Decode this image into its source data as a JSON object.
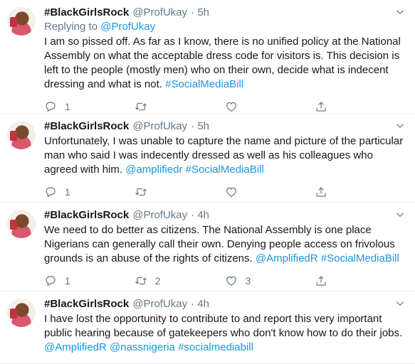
{
  "tweets": [
    {
      "display_name": "#BlackGirlsRock",
      "handle": "@ProfUkay",
      "time": "· 5h",
      "replying_prefix": "Replying to ",
      "replying_handle": "@ProfUkay",
      "text": "I am so pissed off. As far as I know, there is no unified policy at the National Assembly on what the acceptable dress code for visitors is. This decision is left to the people (mostly men) who on their own, decide what is indecent dressing and what is not. ",
      "links": [
        "#SocialMediaBill"
      ],
      "reply_count": "1",
      "retweet_count": "",
      "like_count": ""
    },
    {
      "display_name": "#BlackGirlsRock",
      "handle": "@ProfUkay",
      "time": "· 5h",
      "text": "Unfortunately, I was unable to capture the name and picture of the particular man who said I was indecently dressed as well as his colleagues who agreed with him. ",
      "links": [
        "@amplifiedr",
        "#SocialMediaBill"
      ],
      "reply_count": "1",
      "retweet_count": "",
      "like_count": ""
    },
    {
      "display_name": "#BlackGirlsRock",
      "handle": "@ProfUkay",
      "time": "· 4h",
      "text": "We need to do better as citizens. The National Assembly is one place Nigerians can generally call their own. Denying people access on frivolous grounds is an abuse of the rights of citizens.  ",
      "links": [
        "@AmplifiedR",
        "#SocialMediaBill"
      ],
      "reply_count": "1",
      "retweet_count": "2",
      "like_count": "3"
    },
    {
      "display_name": "#BlackGirlsRock",
      "handle": "@ProfUkay",
      "time": "· 4h",
      "text": "I have lost the opportunity to contribute to and report this very important public hearing because of gatekeepers who don't know how to do their jobs. ",
      "links": [
        "@AmplifiedR",
        "@nassnigeria",
        "#socialmediabill"
      ],
      "reply_count": "",
      "retweet_count": "",
      "like_count": ""
    }
  ],
  "icons": {
    "reply": "reply-icon",
    "retweet": "retweet-icon",
    "like": "like-icon",
    "share": "share-icon",
    "caret": "chevron-down-icon"
  },
  "colors": {
    "link": "#1b95e0",
    "secondary_text": "#657786",
    "divider": "#e6ecf0"
  }
}
